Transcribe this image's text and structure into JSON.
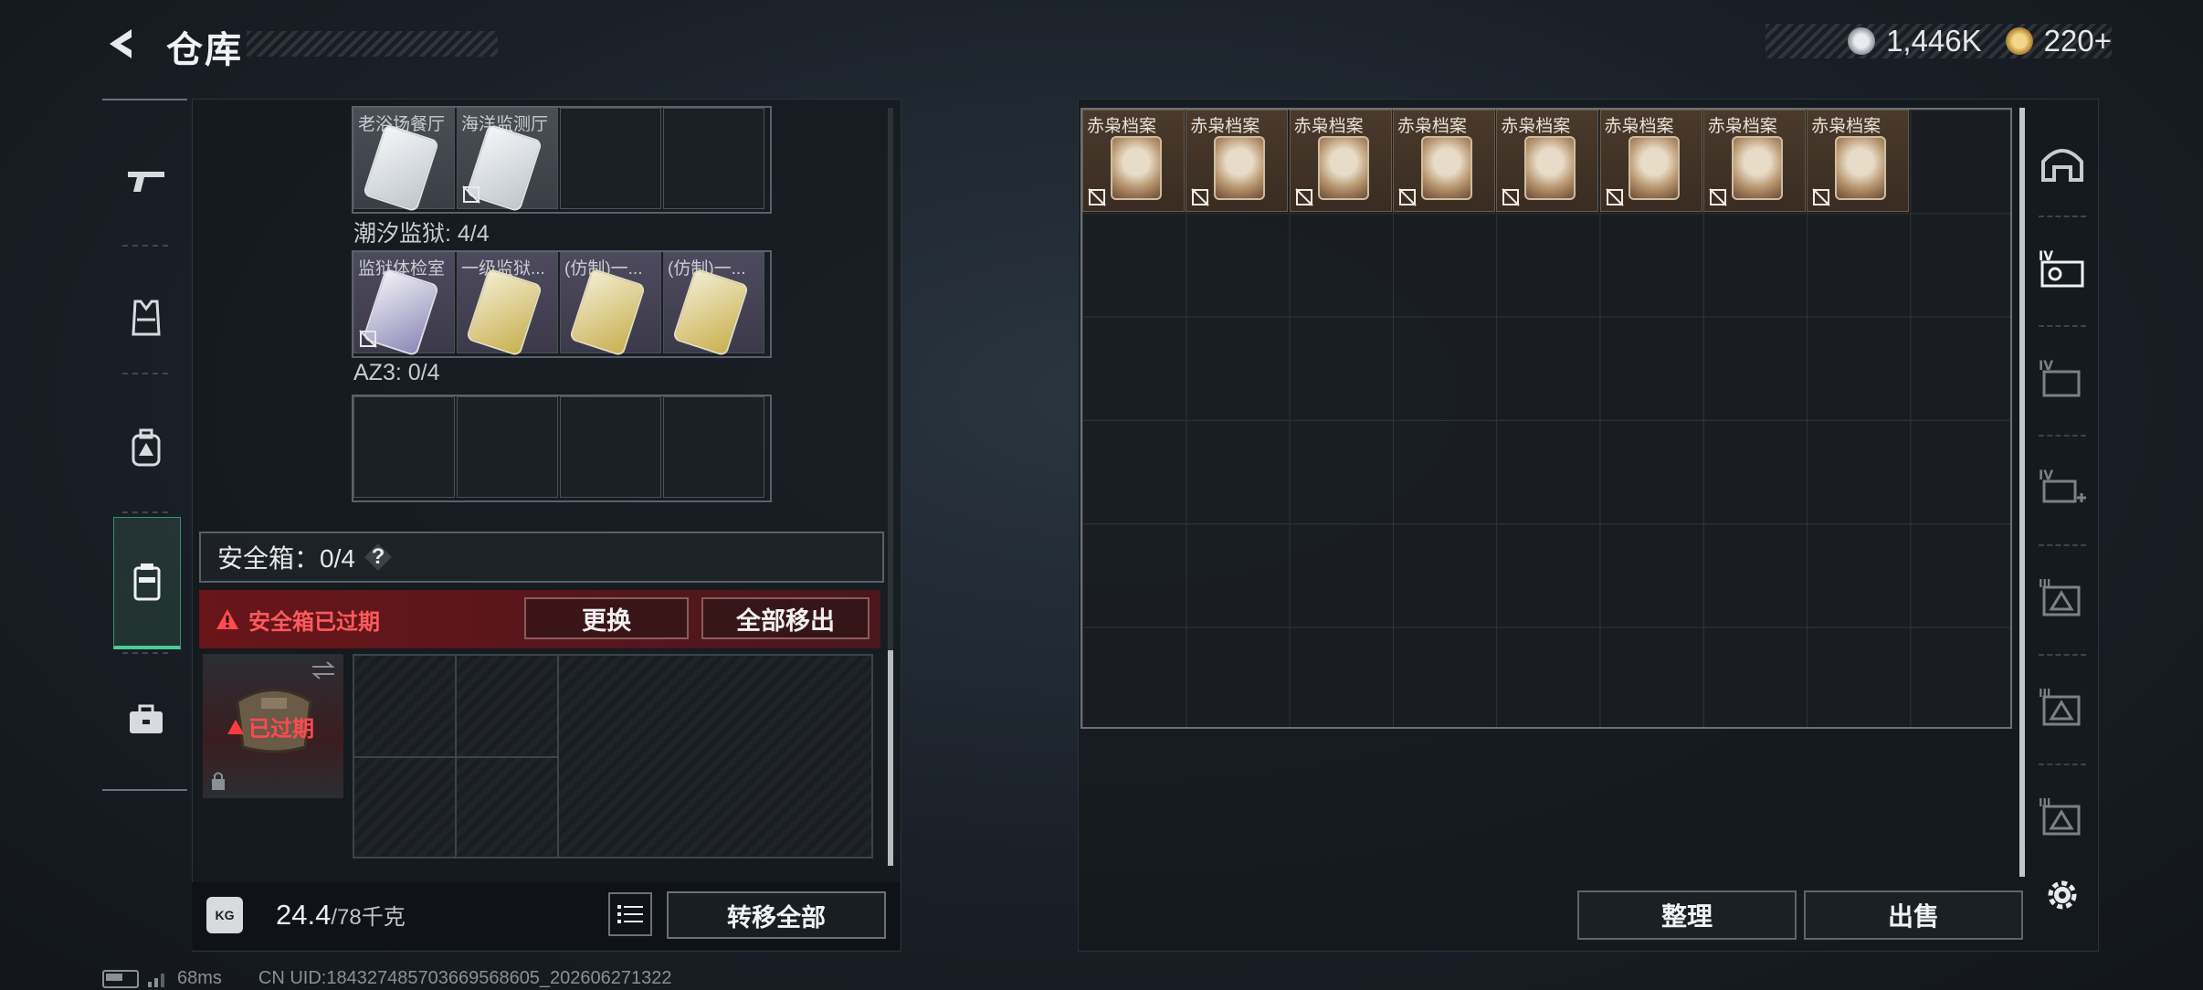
{
  "header": {
    "title": "仓库",
    "currency_a": "1,446K",
    "currency_b": "220+"
  },
  "left_nav": {
    "items": [
      "weapon-icon",
      "armor-vest-icon",
      "backpack-icon",
      "safe-box-icon",
      "toolbox-icon"
    ],
    "active": "safe-box-icon"
  },
  "groups": [
    {
      "label": "",
      "slots": [
        {
          "label": "老浴场餐厅",
          "filled": true,
          "nobind": false
        },
        {
          "label": "海洋监测厅",
          "filled": true,
          "nobind": true
        },
        {
          "label": "",
          "filled": false
        },
        {
          "label": "",
          "filled": false
        }
      ]
    },
    {
      "label": "潮汐监狱: 4/4",
      "slots": [
        {
          "label": "监狱体检室",
          "filled": true,
          "nobind": true
        },
        {
          "label": "一级监狱...",
          "filled": true,
          "nobind": false
        },
        {
          "label": "(仿制)一...",
          "filled": true,
          "nobind": false
        },
        {
          "label": "(仿制)一...",
          "filled": true,
          "nobind": false
        }
      ]
    },
    {
      "label": "AZ3: 0/4",
      "slots": []
    }
  ],
  "safe_box": {
    "header": "安全箱：0/4",
    "help": "?",
    "expired_text": "安全箱已过期",
    "replace_btn": "更换",
    "remove_all_btn": "全部移出",
    "card_status": "已过期"
  },
  "bottom": {
    "weight_current": "24.4",
    "weight_max": "/78千克",
    "weight_icon": "KG",
    "transfer_btn": "转移全部"
  },
  "stash": {
    "items": [
      {
        "label": "赤枭档案"
      },
      {
        "label": "赤枭档案"
      },
      {
        "label": "赤枭档案"
      },
      {
        "label": "赤枭档案"
      },
      {
        "label": "赤枭档案"
      },
      {
        "label": "赤枭档案"
      },
      {
        "label": "赤枭档案"
      },
      {
        "label": "赤枭档案"
      }
    ],
    "sort_btn": "整理",
    "sell_btn": "出售"
  },
  "right_tabs": [
    "helmet-tab-icon",
    "tab-iv-1-icon",
    "tab-iv-2-icon",
    "tab-iv-3-icon",
    "tab-iii-1-icon",
    "tab-iii-2-icon",
    "tab-iii-3-icon"
  ],
  "status": {
    "ping": "68ms",
    "uid": "CN UID:184327485703669568605_202606271322"
  },
  "colors": {
    "accent_green": "#4cc99a",
    "danger_red": "#e0343a",
    "item_brown": "#4a3a2c"
  }
}
